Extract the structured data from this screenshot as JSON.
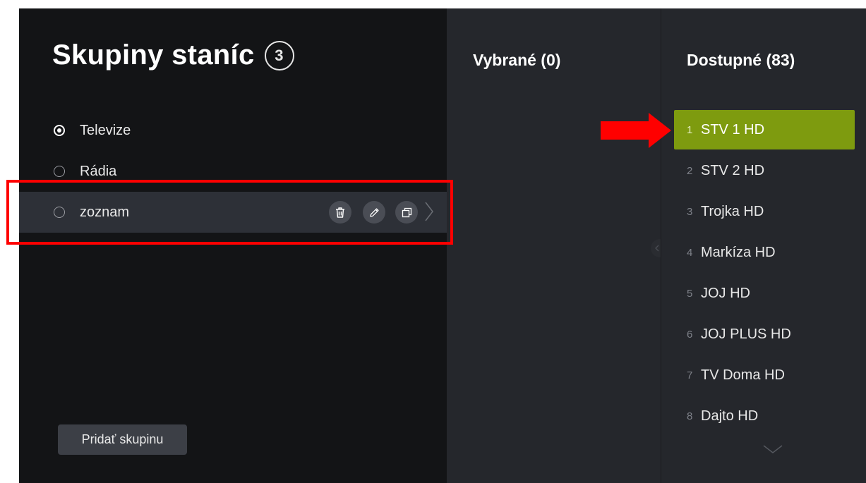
{
  "groups_panel": {
    "title": "Skupiny staníc",
    "count": "3",
    "groups": [
      {
        "label": "Televize"
      },
      {
        "label": "Rádia"
      },
      {
        "label": "zoznam"
      }
    ],
    "add_button": "Pridať skupinu"
  },
  "selected_panel": {
    "title": "Vybrané (0)"
  },
  "available_panel": {
    "title": "Dostupné (83)",
    "channels": [
      {
        "num": "1",
        "name": "STV 1 HD"
      },
      {
        "num": "2",
        "name": "STV 2 HD"
      },
      {
        "num": "3",
        "name": "Trojka HD"
      },
      {
        "num": "4",
        "name": "Markíza HD"
      },
      {
        "num": "5",
        "name": "JOJ HD"
      },
      {
        "num": "6",
        "name": "JOJ PLUS HD"
      },
      {
        "num": "7",
        "name": "TV Doma HD"
      },
      {
        "num": "8",
        "name": "Dajto HD"
      }
    ]
  },
  "colors": {
    "selected_channel": "#7e9b0f",
    "annotation": "#ff0000"
  }
}
